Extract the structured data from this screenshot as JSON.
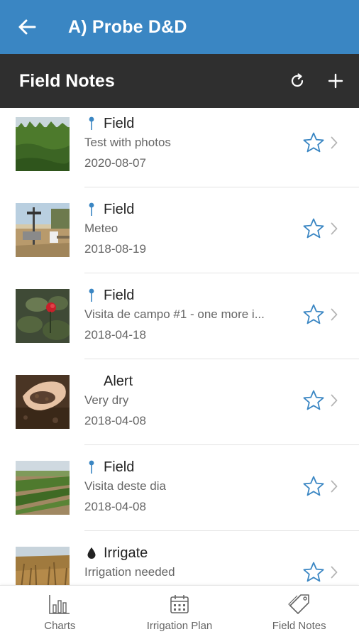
{
  "appbar": {
    "title": "A) Probe D&D",
    "back_icon": "arrow-left-icon",
    "color": "#3a86c3"
  },
  "subbar": {
    "title": "Field Notes",
    "refresh_icon": "refresh-icon",
    "add_icon": "plus-icon",
    "color": "#2f2f2f"
  },
  "notes": [
    {
      "category": "Field",
      "category_icon": "pin-icon",
      "description": "Test with photos",
      "date": "2020-08-07",
      "thumbnail": "orchard-photo"
    },
    {
      "category": "Field",
      "category_icon": "pin-icon",
      "description": "Meteo",
      "date": "2018-08-19",
      "thumbnail": "weather-station-photo"
    },
    {
      "category": "Field",
      "category_icon": "pin-icon",
      "description": "Visita de campo #1 - one more i...",
      "date": "2018-04-18",
      "thumbnail": "rose-photo"
    },
    {
      "category": "Alert",
      "category_icon": "",
      "description": "Very dry",
      "date": "2018-04-08",
      "thumbnail": "soil-hand-photo"
    },
    {
      "category": "Field",
      "category_icon": "pin-icon",
      "description": "Visita deste dia",
      "date": "2018-04-08",
      "thumbnail": "vineyard-photo"
    },
    {
      "category": "Irrigate",
      "category_icon": "drop-icon",
      "description": "Irrigation needed",
      "date": "",
      "thumbnail": "dry-grass-photo"
    }
  ],
  "tabs": [
    {
      "label": "Charts",
      "icon": "bar-chart-icon"
    },
    {
      "label": "Irrigation Plan",
      "icon": "calendar-icon"
    },
    {
      "label": "Field Notes",
      "icon": "tag-icon"
    }
  ],
  "colors": {
    "accent": "#3a86c3",
    "star": "#3a86c3",
    "text_secondary": "#666666"
  }
}
